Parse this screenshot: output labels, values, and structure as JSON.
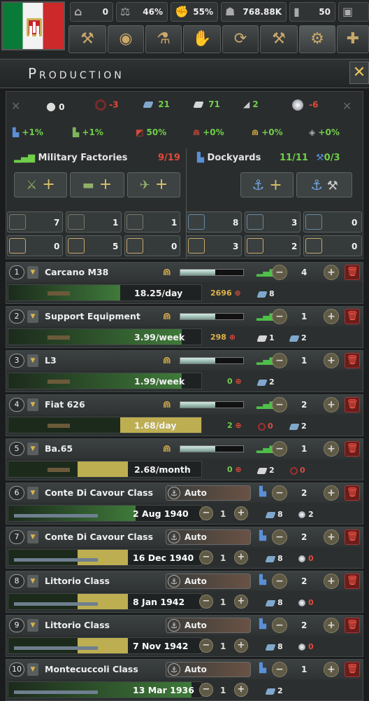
{
  "topbar": {
    "resources": [
      {
        "icon": "civilian-factory-icon",
        "value": "0"
      },
      {
        "icon": "stability-icon",
        "value": "46%"
      },
      {
        "icon": "war-support-icon",
        "value": "55%"
      },
      {
        "icon": "manpower-icon",
        "value": "768.88K"
      },
      {
        "icon": "factories-icon",
        "value": "50"
      },
      {
        "icon": "convoys-icon",
        "value": ""
      }
    ],
    "buttons": [
      "politics-icon",
      "intelligence-icon",
      "research-icon",
      "diplomacy-icon",
      "trade-icon",
      "construction-icon",
      "production-icon",
      "logistics-icon"
    ]
  },
  "header": {
    "title": "Production",
    "close": "✕"
  },
  "resources": [
    {
      "name": "oil",
      "value": "0",
      "color": "#eeeeee"
    },
    {
      "name": "rubber",
      "value": "-3",
      "color": "#e24a3a"
    },
    {
      "name": "steel",
      "value": "21",
      "color": "#6fcf4a"
    },
    {
      "name": "aluminium",
      "value": "71",
      "color": "#6fcf4a"
    },
    {
      "name": "tungsten",
      "value": "2",
      "color": "#6fcf4a"
    },
    {
      "name": "chromium",
      "value": "-6",
      "color": "#e24a3a"
    }
  ],
  "bonuses": [
    "+1%",
    "+1%",
    "50%",
    "+0%",
    "+0%",
    "+0%"
  ],
  "military": {
    "label": "Military Factories",
    "count": "9/19"
  },
  "dockyards": {
    "label": "Dockyards",
    "count": "11/11",
    "repair": "0/3"
  },
  "lines_row1": [
    "7",
    "1",
    "1",
    "8",
    "3",
    "0"
  ],
  "lines_row2": [
    "0",
    "5",
    "0",
    "3",
    "2",
    "0"
  ],
  "production": [
    {
      "index": "1",
      "name": "Carcano M38",
      "speed": "18.25/day",
      "progress": 0.58,
      "yellow": false,
      "stock": "2696",
      "factories": "4",
      "res": [
        {
          "type": "s",
          "v": "8"
        }
      ]
    },
    {
      "index": "2",
      "name": "Support Equipment",
      "speed": "3.99/week",
      "progress": 0.9,
      "yellow": false,
      "stock": "298",
      "factories": "1",
      "res": [
        {
          "type": "c",
          "v": "1"
        },
        {
          "type": "s",
          "v": "2"
        }
      ]
    },
    {
      "index": "3",
      "name": "L3",
      "speed": "1.99/week",
      "progress": 0.9,
      "yellow": false,
      "stock": "0",
      "factories": "1",
      "res": [
        {
          "type": "s",
          "v": "2"
        }
      ]
    },
    {
      "index": "4",
      "name": "Fiat 626",
      "speed": "1.68/day",
      "progress": 1.0,
      "yellow": true,
      "stock": "2",
      "factories": "2",
      "res": [
        {
          "type": "r",
          "v": "0"
        },
        {
          "type": "s",
          "v": "2"
        }
      ]
    },
    {
      "index": "5",
      "name": "Ba.65",
      "speed": "2.68/month",
      "progress": 0.62,
      "yellow": true,
      "stock": "0",
      "factories": "1",
      "res": [
        {
          "type": "c",
          "v": "2"
        },
        {
          "type": "r",
          "v": "0"
        }
      ]
    }
  ],
  "naval": [
    {
      "index": "6",
      "name": "Conte Di Cavour Class",
      "mode": "Auto",
      "date": "2 Aug 1940",
      "progress": 0.66,
      "yellow": false,
      "factories": "2",
      "count": "1",
      "res": [
        {
          "type": "s",
          "v": "8"
        },
        {
          "type": "o",
          "v": "2"
        }
      ],
      "ocolor": "#eeeeee"
    },
    {
      "index": "7",
      "name": "Conte Di Cavour Class",
      "mode": "Auto",
      "date": "16 Dec 1940",
      "progress": 0.62,
      "yellow": true,
      "factories": "2",
      "count": "1",
      "res": [
        {
          "type": "s",
          "v": "8"
        },
        {
          "type": "o",
          "v": "0"
        }
      ],
      "ocolor": "#e24a3a"
    },
    {
      "index": "8",
      "name": "Littorio Class",
      "mode": "Auto",
      "date": "8 Jan 1942",
      "progress": 0.62,
      "yellow": true,
      "factories": "2",
      "count": "1",
      "res": [
        {
          "type": "s",
          "v": "8"
        },
        {
          "type": "o",
          "v": "0"
        }
      ],
      "ocolor": "#e24a3a"
    },
    {
      "index": "9",
      "name": "Littorio Class",
      "mode": "Auto",
      "date": "7 Nov 1942",
      "progress": 0.62,
      "yellow": true,
      "factories": "2",
      "count": "1",
      "res": [
        {
          "type": "s",
          "v": "8"
        },
        {
          "type": "o",
          "v": "0"
        }
      ],
      "ocolor": "#e24a3a"
    },
    {
      "index": "10",
      "name": "Montecuccoli Class",
      "mode": "Auto",
      "date": "13 Mar 1936",
      "progress": 0.95,
      "yellow": false,
      "factories": "1",
      "count": "1",
      "res": [
        {
          "type": "s",
          "v": "2"
        }
      ],
      "ocolor": "#eeeeee"
    }
  ]
}
